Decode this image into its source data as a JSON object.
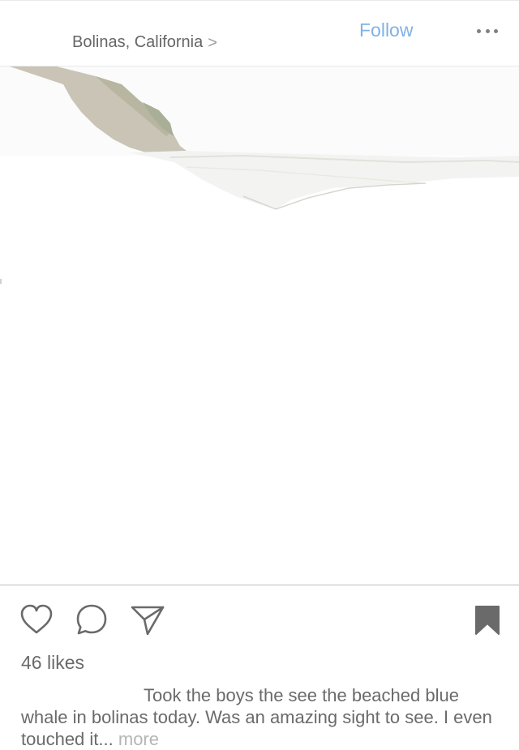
{
  "header": {
    "location": "Bolinas, California",
    "location_chevron": ">",
    "follow_label": "Follow",
    "more_icon": "ellipsis-icon"
  },
  "photo": {
    "subject": "washed-out coastal cliff and beach"
  },
  "actions": {
    "like_icon": "heart-icon",
    "comment_icon": "comment-bubble-icon",
    "share_icon": "paper-plane-icon",
    "save_icon": "bookmark-icon"
  },
  "likes": "46 likes",
  "caption": {
    "text": "Took the boys the see the beached blue whale in bolinas today. Was an amazing sight to see. I even touched it...",
    "more_label": "more"
  },
  "colors": {
    "accent": "#7fb2e6",
    "text": "#6a6a6a",
    "muted": "#b5b5b5"
  }
}
